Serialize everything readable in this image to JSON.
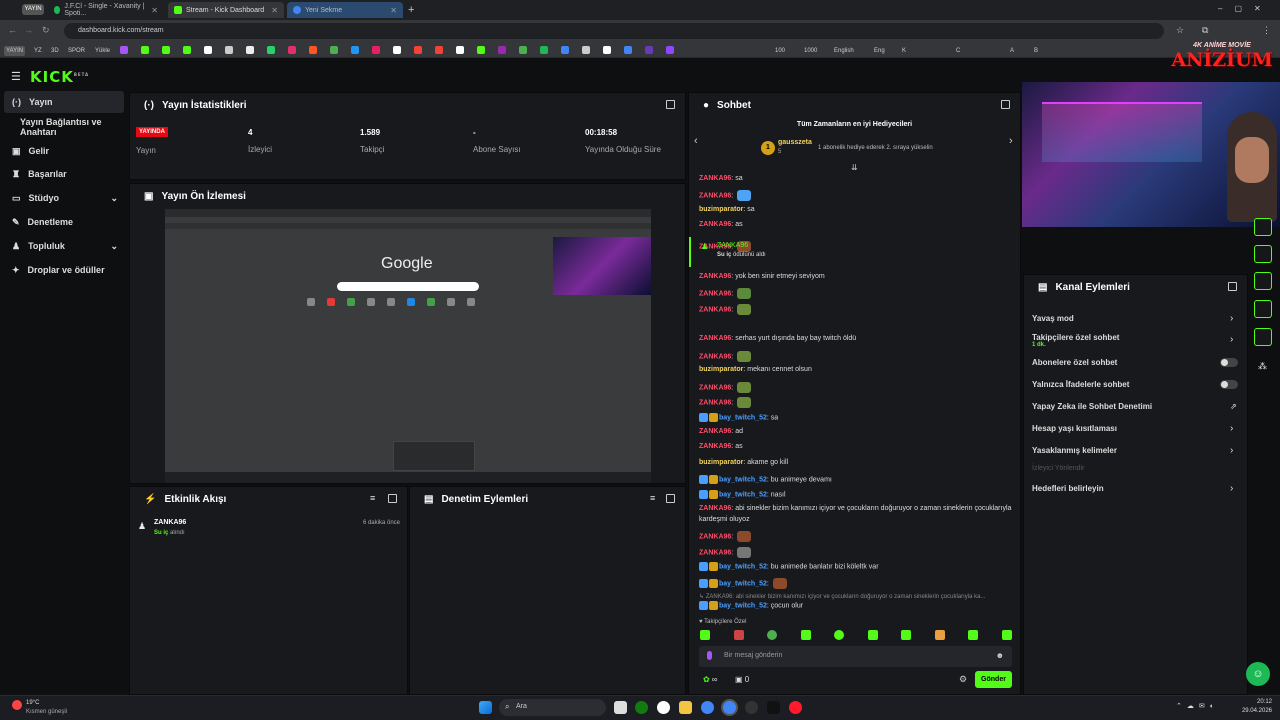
{
  "browser": {
    "profile_badge": "YAYIN",
    "tabs": [
      {
        "label": "J.F.Cl - Single - Xavanity | Spoti...",
        "active": false
      },
      {
        "label": "Stream - Kick Dashboard",
        "active": true
      },
      {
        "label": "Yeni Sekme",
        "active": false
      }
    ],
    "new_tab": "+",
    "url": "dashboard.kick.com/stream",
    "bookmarks": [
      "YAYIN",
      "YZ",
      "3D",
      "SPOR",
      "Yükle",
      "100",
      "1000",
      "English",
      "Eng",
      "K",
      "C",
      "A",
      "B"
    ]
  },
  "overlay": {
    "top": "4K ANİME MOVİE",
    "brand": "ANİZİUM"
  },
  "kick": {
    "logo": "KICK",
    "logo_sup": "BETA",
    "sidebar": [
      {
        "label": "Yayın",
        "icon": "stream-icon",
        "active": true
      },
      {
        "label": "Yayın Bağlantısı ve Anahtarı",
        "icon": "",
        "active": false
      },
      {
        "label": "Gelir",
        "icon": "money-icon",
        "active": false
      },
      {
        "label": "Başarılar",
        "icon": "trophy-icon",
        "active": false
      },
      {
        "label": "Stüdyo",
        "icon": "studio-icon",
        "active": false,
        "expand": true
      },
      {
        "label": "Denetleme",
        "icon": "wrench-icon",
        "active": false
      },
      {
        "label": "Topluluk",
        "icon": "community-icon",
        "active": false,
        "expand": true
      },
      {
        "label": "Droplar ve ödüller",
        "icon": "gift-icon",
        "active": false
      }
    ],
    "stats_panel": {
      "title": "Yayın İstatistikleri",
      "live_badge": "YAYINDA",
      "live_label": "Yayın",
      "stats": [
        {
          "value": "4",
          "label": "İzleyici"
        },
        {
          "value": "1.589",
          "label": "Takipçi"
        },
        {
          "value": "-",
          "label": "Abone Sayısı"
        },
        {
          "value": "00:18:58",
          "label": "Yayında Olduğu Süre"
        }
      ]
    },
    "preview_panel": {
      "title": "Yayın Ön İzlemesi",
      "google": "Google"
    },
    "activity_panel": {
      "title": "Etkinlik Akışı",
      "items": [
        {
          "user": "ZANKA96",
          "action": "Su iç",
          "suffix": "alındı",
          "time": "6 dakika önce"
        }
      ]
    },
    "moderation_panel": {
      "title": "Denetim Eylemleri"
    },
    "chat": {
      "title": "Sohbet",
      "leaderboard_title": "Tüm Zamanların en iyi Hediyecileri",
      "top_rank": "1",
      "top_user": "gausszeta",
      "top_count": "5",
      "promo": "1 abonelik hediye ederek 2. sıraya yükselin",
      "messages": [
        {
          "user": "ZANKA96",
          "cls": "red",
          "text": "sa",
          "emote": false
        },
        {
          "user": "ZANKA96",
          "cls": "red",
          "text": "",
          "emote": true
        },
        {
          "user": "buzimparator",
          "cls": "yel",
          "text": "sa",
          "emote": false
        },
        {
          "user": "ZANKA96",
          "cls": "red",
          "text": "as",
          "emote": false
        },
        {
          "user": "ZANKA96",
          "cls": "red",
          "text": "",
          "emote": true
        },
        {
          "user": "ZANKA96",
          "cls": "red",
          "text": "yok ben sinir etmeyi seviyom",
          "emote": false
        },
        {
          "user": "ZANKA96",
          "cls": "red",
          "text": "",
          "emote": true
        },
        {
          "user": "ZANKA96",
          "cls": "red",
          "text": "",
          "emote": true
        },
        {
          "user": "ZANKA96",
          "cls": "red",
          "text": "serhas yurt dışında bay bay twitch öldü",
          "emote": false
        },
        {
          "user": "ZANKA96",
          "cls": "red",
          "text": "",
          "emote": true
        },
        {
          "user": "buzimparator",
          "cls": "yel",
          "text": "mekanı cennet olsun",
          "emote": false
        },
        {
          "user": "ZANKA96",
          "cls": "red",
          "text": "",
          "emote": true
        },
        {
          "user": "ZANKA96",
          "cls": "red",
          "text": "",
          "emote": true
        },
        {
          "user": "bay_twitch_52",
          "cls": "blu",
          "text": "sa",
          "emote": false
        },
        {
          "user": "ZANKA96",
          "cls": "red",
          "text": "ad",
          "emote": false
        },
        {
          "user": "ZANKA96",
          "cls": "red",
          "text": "as",
          "emote": false
        },
        {
          "user": "buzimparator",
          "cls": "yel",
          "text": "akame go kill",
          "emote": false
        },
        {
          "user": "bay_twitch_52",
          "cls": "blu",
          "text": "bu animeye devamı",
          "emote": false
        },
        {
          "user": "bay_twitch_52",
          "cls": "blu",
          "text": "nasıl",
          "emote": false
        },
        {
          "user": "ZANKA96",
          "cls": "red",
          "text": "abi sinekler bizim kanımızı içiyor ve çocukların doğuruyor o zaman sineklerin çocuklarıyla",
          "emote": false
        },
        {
          "user": "",
          "cls": "",
          "text": "kardeşmi oluyoz",
          "emote": false
        },
        {
          "user": "ZANKA96",
          "cls": "red",
          "text": "",
          "emote": true
        },
        {
          "user": "ZANKA96",
          "cls": "red",
          "text": "",
          "emote": true
        },
        {
          "user": "bay_twitch_52",
          "cls": "blu",
          "text": "bu animede banlatır bizi köleltk var",
          "emote": false
        },
        {
          "user": "bay_twitch_52",
          "cls": "blu",
          "text": "",
          "emote": true
        },
        {
          "user": "",
          "cls": "",
          "text": "↳ ZANKA96: abi sinekler bizim kanımızı içiyor ve çocukların doğuruyor o zaman sineklerin çocuklarıyla ka...",
          "emote": false
        },
        {
          "user": "bay_twitch_52",
          "cls": "blu",
          "text": "çocun olur",
          "emote": false
        }
      ],
      "mode_label": "Takipçilere Özel",
      "input_placeholder": "Bir mesaj gönderin",
      "infinity": "∞",
      "count": "0",
      "send_label": "Gönder"
    },
    "kanal": {
      "title": "Kanal Eylemleri",
      "items": [
        {
          "label": "Yavaş mod",
          "control": "chevron"
        },
        {
          "label": "Takipçilere özel sohbet",
          "sub": "1 dk.",
          "control": "chevron"
        },
        {
          "label": "Abonelere özel sohbet",
          "control": "toggle"
        },
        {
          "label": "Yalnızca İfadelerle sohbet",
          "control": "toggle"
        },
        {
          "label": "Yapay Zeka ile Sohbet Denetimi",
          "control": "external"
        },
        {
          "label": "Hesap yaşı kısıtlaması",
          "control": "chevron"
        },
        {
          "label": "Yasaklanmış kelimeler",
          "control": "chevron"
        },
        {
          "label": "İzleyici Yönlendir",
          "control": "disabled"
        },
        {
          "label": "Hedefleri belirleyin",
          "control": "chevron"
        }
      ]
    }
  },
  "taskbar": {
    "weather_temp": "19°C",
    "weather_desc": "Kısmen güneşli",
    "search": "Ara",
    "time": "20:12",
    "date": "29.04.2026"
  }
}
